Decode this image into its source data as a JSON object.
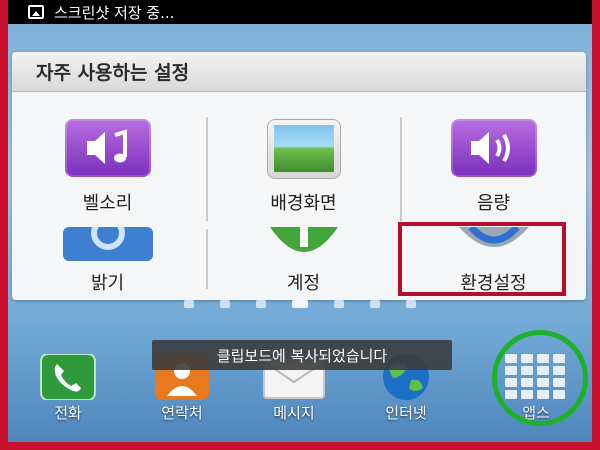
{
  "status_bar": {
    "notification": "스크린샷 저장 중..."
  },
  "widget": {
    "title": "자주 사용하는 설정",
    "row1": [
      {
        "label": "벨소리",
        "icon": "ringtone-icon"
      },
      {
        "label": "배경화면",
        "icon": "wallpaper-icon"
      },
      {
        "label": "음량",
        "icon": "volume-icon"
      }
    ],
    "row2": [
      {
        "label": "밝기",
        "icon": "brightness-icon"
      },
      {
        "label": "계정",
        "icon": "account-icon"
      },
      {
        "label": "환경설정",
        "icon": "settings-gear-icon"
      }
    ]
  },
  "toast": {
    "text": "클립보드에 복사되었습니다"
  },
  "dock": [
    {
      "label": "전화",
      "icon": "phone-icon"
    },
    {
      "label": "연락처",
      "icon": "contacts-icon"
    },
    {
      "label": "메시지",
      "icon": "message-icon"
    },
    {
      "label": "인터넷",
      "icon": "globe-icon"
    },
    {
      "label": "앱스",
      "icon": "apps-grid-icon"
    }
  ],
  "page_indicator": {
    "count": 7,
    "active": 3
  },
  "colors": {
    "highlight_rect": "#b30f2d",
    "highlight_circle": "#1fb02a",
    "frame": "#c8102e"
  }
}
